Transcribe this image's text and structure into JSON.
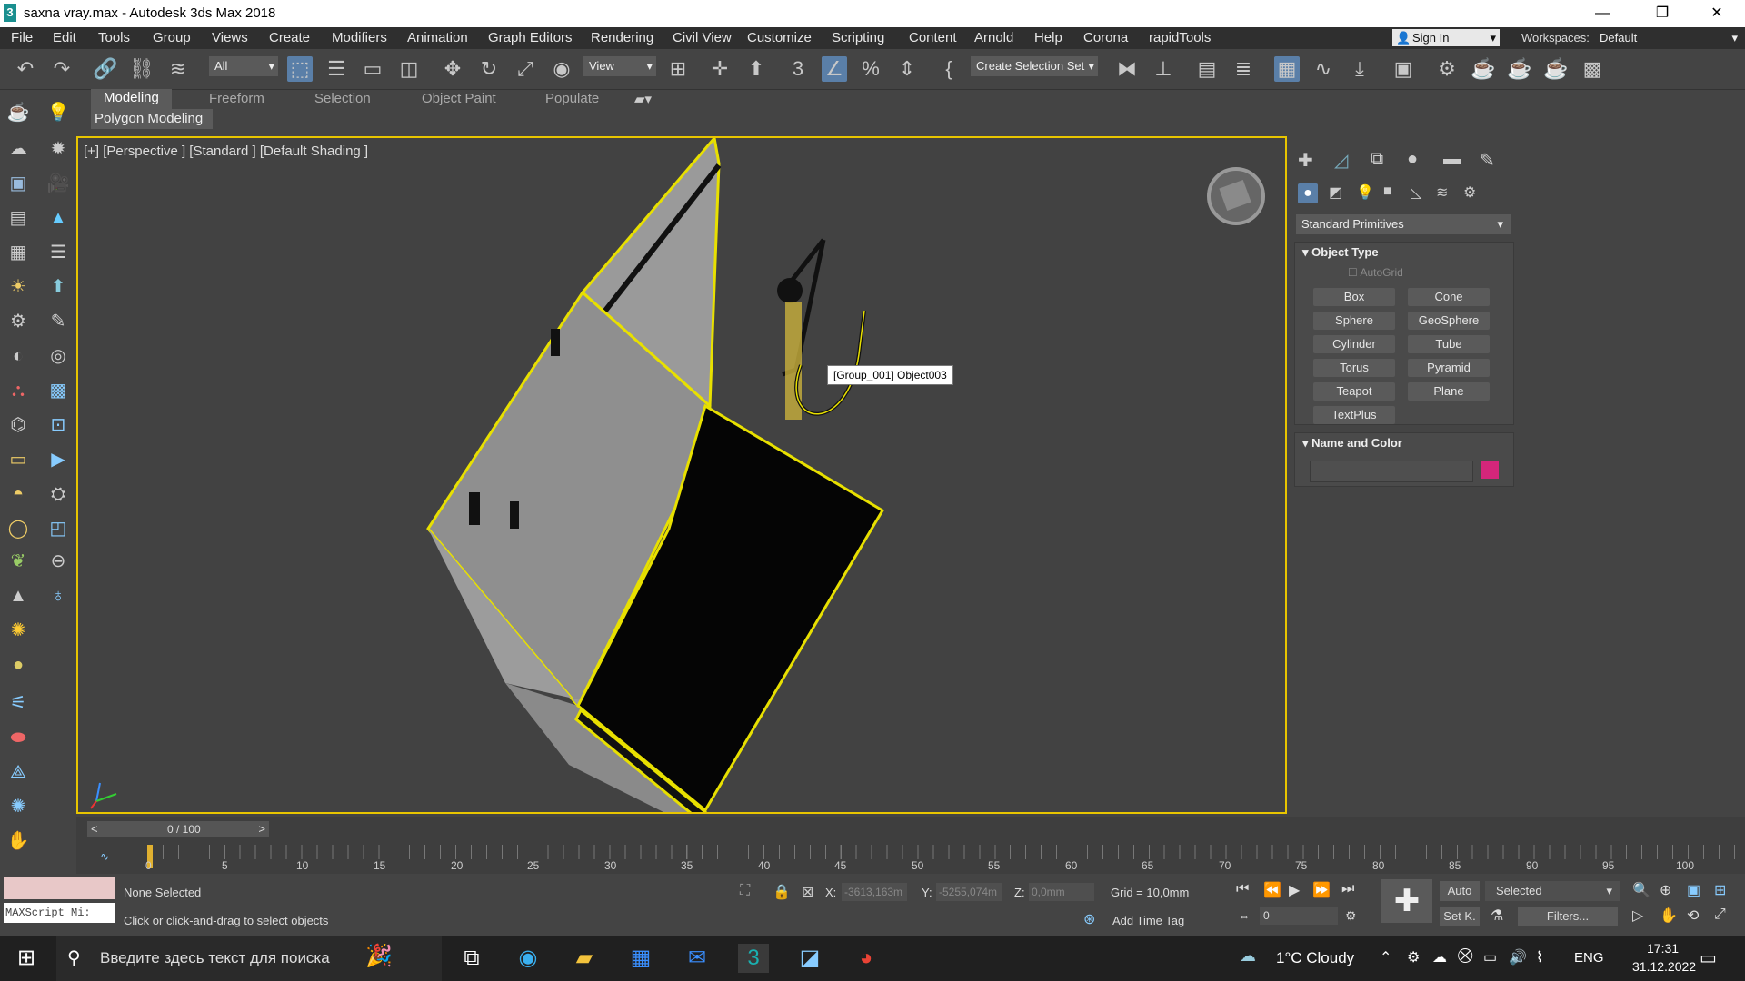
{
  "window": {
    "title": "saxna vray.max - Autodesk 3ds Max 2018",
    "app_icon": "3",
    "minimize": "—",
    "maximize": "❐",
    "close": "✕"
  },
  "menu": [
    "File",
    "Edit",
    "Tools",
    "Group",
    "Views",
    "Create",
    "Modifiers",
    "Animation",
    "Graph Editors",
    "Rendering",
    "Civil View",
    "Customize",
    "Scripting",
    "Content",
    "Arnold",
    "Help",
    "Corona",
    "rapidTools"
  ],
  "signin": "Sign In",
  "workspaces": {
    "label": "Workspaces:",
    "value": "Default"
  },
  "toolbar": {
    "filter": "All",
    "ref_coord": "View",
    "selection_set": "Create Selection Set"
  },
  "ribbon": {
    "tabs": [
      "Modeling",
      "Freeform",
      "Selection",
      "Object Paint",
      "Populate"
    ],
    "active": "Modeling",
    "panel": "Polygon Modeling"
  },
  "viewport": {
    "label": "[+] [Perspective ] [Standard ] [Default Shading ]",
    "tooltip": "[Group_001] Object003"
  },
  "command_panel": {
    "category": "Standard Primitives",
    "object_type_title": "Object Type",
    "autogrid": "AutoGrid",
    "buttons": [
      "Box",
      "Cone",
      "Sphere",
      "GeoSphere",
      "Cylinder",
      "Tube",
      "Torus",
      "Pyramid",
      "Teapot",
      "Plane",
      "TextPlus"
    ],
    "name_color_title": "Name and Color",
    "color": "#d4267a"
  },
  "timeline": {
    "frame": "0 / 100",
    "prev": "<",
    "next": ">",
    "ticks": [
      "0",
      "5",
      "10",
      "15",
      "20",
      "25",
      "30",
      "35",
      "40",
      "45",
      "50",
      "55",
      "60",
      "65",
      "70",
      "75",
      "80",
      "85",
      "90",
      "95",
      "100"
    ]
  },
  "status": {
    "maxscript": "MAXScript Mi:",
    "selected": "None Selected",
    "prompt": "Click or click-and-drag to select objects",
    "x_label": "X:",
    "x": "-3613,163m",
    "y_label": "Y:",
    "y": "-5255,074m",
    "z_label": "Z:",
    "z": "0,0mm",
    "grid": "Grid = 10,0mm",
    "add_time_tag": "Add Time Tag",
    "auto": "Auto",
    "selected_dropdown": "Selected",
    "setk": "Set K.",
    "filters": "Filters...",
    "frame_field": "0"
  },
  "taskbar": {
    "search": "Введите здесь текст для поиска",
    "weather": "1°C  Cloudy",
    "lang": "ENG",
    "time": "17:31",
    "date": "31.12.2022"
  }
}
